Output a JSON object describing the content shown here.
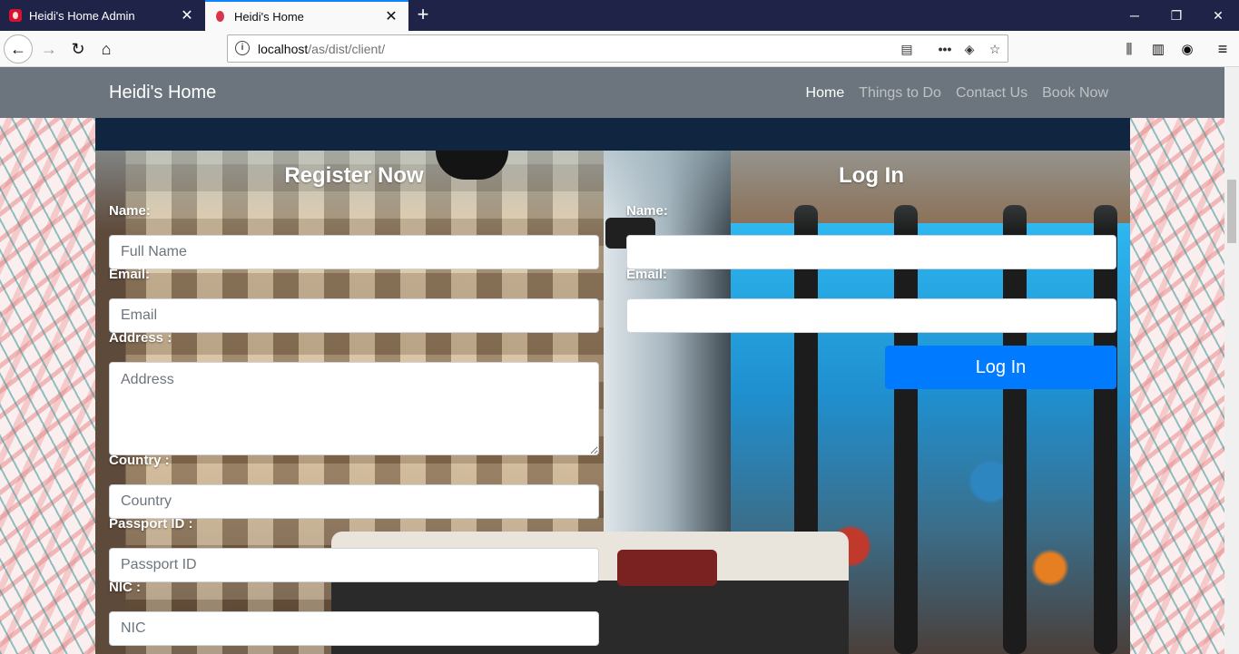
{
  "browser": {
    "tabs": [
      {
        "title": "Heidi's Home Admin",
        "active": false
      },
      {
        "title": "Heidi's Home",
        "active": true
      }
    ],
    "url_host": "localhost",
    "url_path": "/as/dist/client/"
  },
  "site": {
    "brand": "Heidi's Home",
    "nav": [
      {
        "label": "Home",
        "active": true
      },
      {
        "label": "Things to Do",
        "active": false
      },
      {
        "label": "Contact Us",
        "active": false
      },
      {
        "label": "Book Now",
        "active": false
      }
    ]
  },
  "register": {
    "title": "Register Now",
    "name_label": "Name:",
    "name_placeholder": "Full Name",
    "email_label": "Email:",
    "email_placeholder": "Email",
    "address_label": "Address :",
    "address_placeholder": "Address",
    "country_label": "Country :",
    "country_placeholder": "Country",
    "passport_label": "Passport ID :",
    "passport_placeholder": "Passport ID",
    "nic_label": "NIC :",
    "nic_placeholder": "NIC"
  },
  "login": {
    "title": "Log In",
    "name_label": "Name:",
    "name_value": "",
    "email_label": "Email:",
    "email_value": "",
    "button_label": "Log In"
  },
  "colors": {
    "navbar": "#6c757d",
    "primary_button": "#007bff",
    "dark_strip": "#0f2540",
    "tab_bar": "#1f2347"
  }
}
